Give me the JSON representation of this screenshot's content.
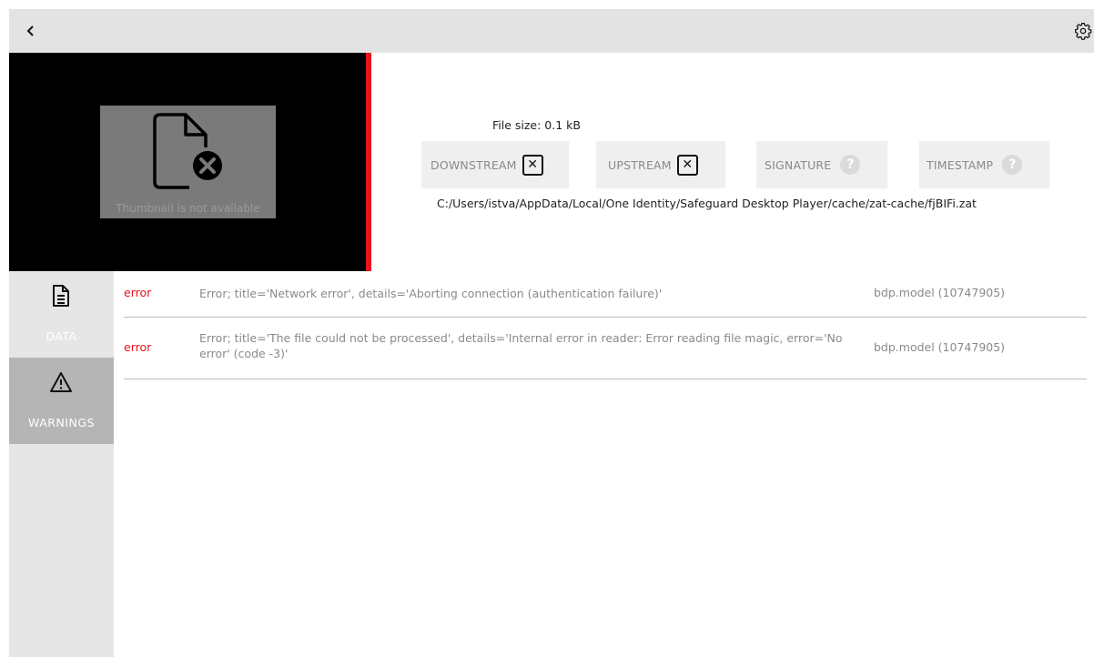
{
  "header": {
    "back_icon": "chevron-left-icon",
    "settings_icon": "gear-icon"
  },
  "thumbnail": {
    "icon": "file-error-icon",
    "caption": "Thumbnail is not available"
  },
  "info": {
    "file_size": "File size: 0.1 kB",
    "badges": [
      {
        "label": "DOWNSTREAM",
        "state": "x"
      },
      {
        "label": "UPSTREAM",
        "state": "x"
      },
      {
        "label": "SIGNATURE",
        "state": "?"
      },
      {
        "label": "TIMESTAMP",
        "state": "?"
      }
    ],
    "path": "C:/Users/istva/AppData/Local/One Identity/Safeguard Desktop Player/cache/zat-cache/fjBIFi.zat"
  },
  "sidebar": {
    "items": [
      {
        "label": "DATA",
        "icon": "document-icon"
      },
      {
        "label": "WARNINGS",
        "icon": "warning-icon"
      }
    ]
  },
  "log": {
    "rows": [
      {
        "level": "error",
        "message": "Error; title='Network error', details='Aborting connection (authentication failure)'",
        "source": "bdp.model (10747905)"
      },
      {
        "level": "error",
        "message": "Error; title='The file could not be processed', details='Internal error in reader: Error reading file magic, error='No error' (code -3)'",
        "source": "bdp.model (10747905)"
      }
    ]
  },
  "colors": {
    "accent_red": "#e8131b",
    "titlebar": "#e3e3e3",
    "sidebar": "#e6e6e6",
    "sidebar_active": "#b5b5b5"
  }
}
